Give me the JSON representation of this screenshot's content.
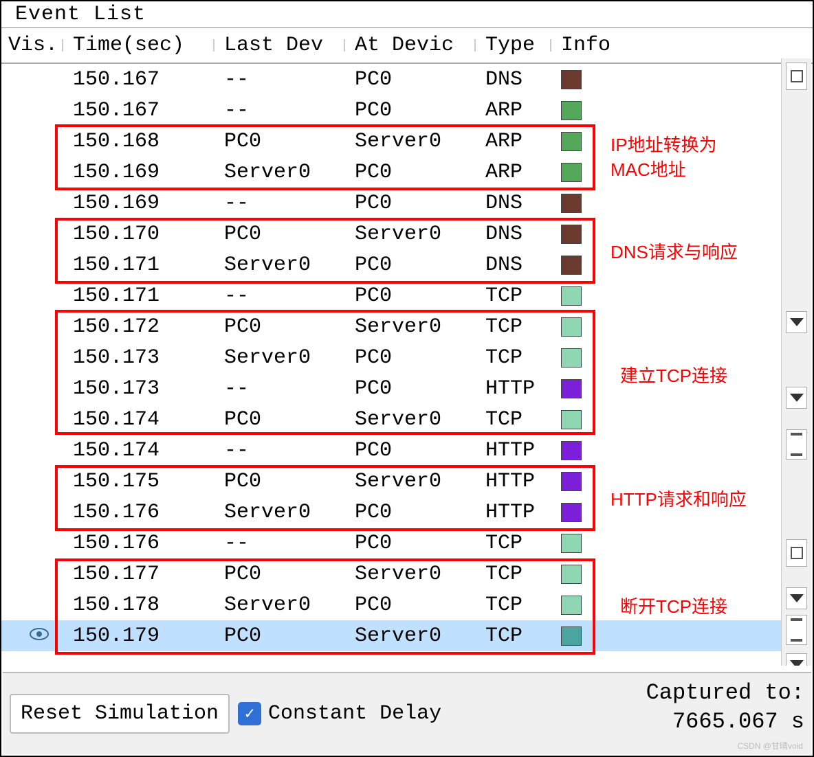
{
  "title": "Event List",
  "columns": {
    "vis": "Vis.",
    "time": "Time(sec)",
    "last": "Last Dev",
    "at": "At Devic",
    "type": "Type",
    "info": "Info"
  },
  "colors": {
    "DNS": "#6b3a2f",
    "ARP": "#53a85a",
    "TCP": "#8fd6b3",
    "HTTP": "#7b1fd8",
    "TCP_SEL": "#4aa4a0"
  },
  "rows": [
    {
      "time": "150.167",
      "last": "--",
      "at": "PC0",
      "type": "DNS",
      "color": "#6b3a2f",
      "selected": false
    },
    {
      "time": "150.167",
      "last": "--",
      "at": "PC0",
      "type": "ARP",
      "color": "#53a85a",
      "selected": false
    },
    {
      "time": "150.168",
      "last": "PC0",
      "at": "Server0",
      "type": "ARP",
      "color": "#53a85a",
      "selected": false
    },
    {
      "time": "150.169",
      "last": "Server0",
      "at": "PC0",
      "type": "ARP",
      "color": "#53a85a",
      "selected": false
    },
    {
      "time": "150.169",
      "last": "--",
      "at": "PC0",
      "type": "DNS",
      "color": "#6b3a2f",
      "selected": false
    },
    {
      "time": "150.170",
      "last": "PC0",
      "at": "Server0",
      "type": "DNS",
      "color": "#6b3a2f",
      "selected": false
    },
    {
      "time": "150.171",
      "last": "Server0",
      "at": "PC0",
      "type": "DNS",
      "color": "#6b3a2f",
      "selected": false
    },
    {
      "time": "150.171",
      "last": "--",
      "at": "PC0",
      "type": "TCP",
      "color": "#8fd6b3",
      "selected": false
    },
    {
      "time": "150.172",
      "last": "PC0",
      "at": "Server0",
      "type": "TCP",
      "color": "#8fd6b3",
      "selected": false
    },
    {
      "time": "150.173",
      "last": "Server0",
      "at": "PC0",
      "type": "TCP",
      "color": "#8fd6b3",
      "selected": false
    },
    {
      "time": "150.173",
      "last": "--",
      "at": "PC0",
      "type": "HTTP",
      "color": "#7b1fd8",
      "selected": false
    },
    {
      "time": "150.174",
      "last": "PC0",
      "at": "Server0",
      "type": "TCP",
      "color": "#8fd6b3",
      "selected": false
    },
    {
      "time": "150.174",
      "last": "--",
      "at": "PC0",
      "type": "HTTP",
      "color": "#7b1fd8",
      "selected": false
    },
    {
      "time": "150.175",
      "last": "PC0",
      "at": "Server0",
      "type": "HTTP",
      "color": "#7b1fd8",
      "selected": false
    },
    {
      "time": "150.176",
      "last": "Server0",
      "at": "PC0",
      "type": "HTTP",
      "color": "#7b1fd8",
      "selected": false
    },
    {
      "time": "150.176",
      "last": "--",
      "at": "PC0",
      "type": "TCP",
      "color": "#8fd6b3",
      "selected": false
    },
    {
      "time": "150.177",
      "last": "PC0",
      "at": "Server0",
      "type": "TCP",
      "color": "#8fd6b3",
      "selected": false
    },
    {
      "time": "150.178",
      "last": "Server0",
      "at": "PC0",
      "type": "TCP",
      "color": "#8fd6b3",
      "selected": false
    },
    {
      "time": "150.179",
      "last": "PC0",
      "at": "Server0",
      "type": "TCP",
      "color": "#4aa4a0",
      "selected": true
    }
  ],
  "annotations": {
    "arp": "IP地址转换为\nMAC地址",
    "dns": "DNS请求与响应",
    "tcp_open": "建立TCP连接",
    "http": "HTTP请求和响应",
    "tcp_close": "断开TCP连接"
  },
  "footer": {
    "reset": "Reset Simulation",
    "constant_delay": "Constant Delay",
    "captured_label": "Captured to:",
    "captured_value": "7665.067 s"
  },
  "watermark": "CSDN @甘晴void"
}
